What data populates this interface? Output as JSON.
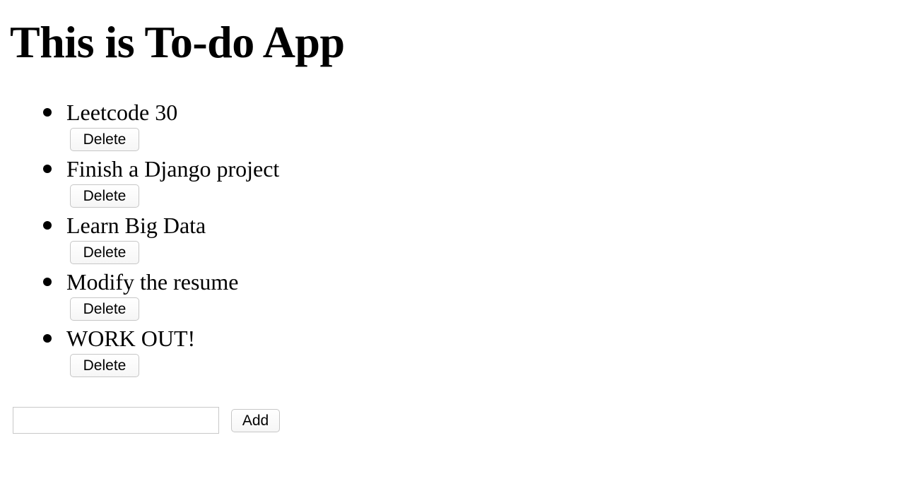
{
  "page": {
    "title": "This is To-do App"
  },
  "todos": [
    {
      "text": "Leetcode 30",
      "delete_label": "Delete"
    },
    {
      "text": "Finish a Django project",
      "delete_label": "Delete"
    },
    {
      "text": "Learn Big Data",
      "delete_label": "Delete"
    },
    {
      "text": "Modify the resume",
      "delete_label": "Delete"
    },
    {
      "text": "WORK OUT!",
      "delete_label": "Delete"
    }
  ],
  "new_item": {
    "value": "",
    "placeholder": "",
    "add_label": "Add"
  }
}
